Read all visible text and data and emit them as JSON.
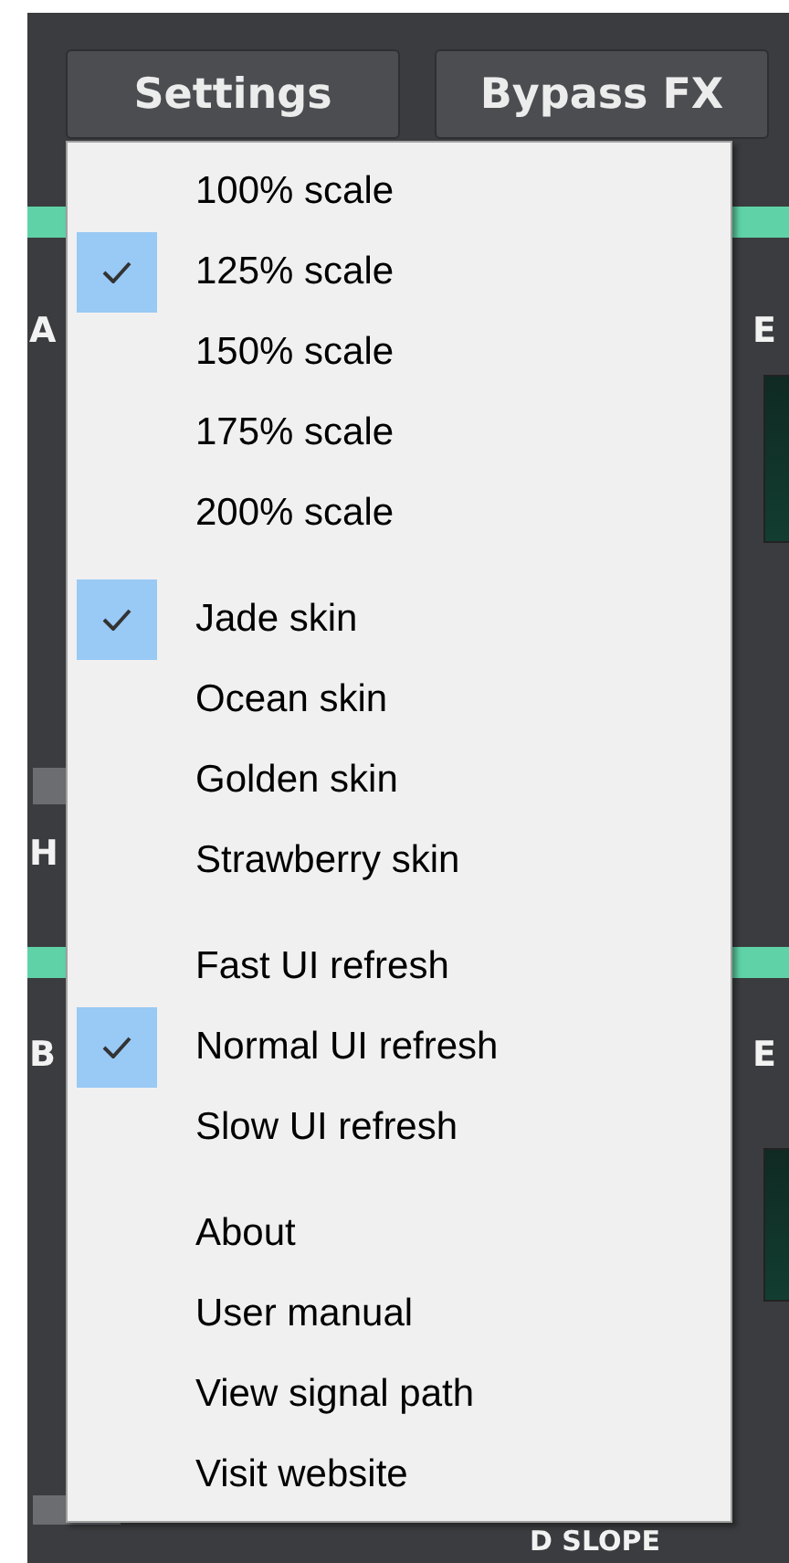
{
  "toolbar": {
    "buttons": [
      {
        "label": "Settings"
      },
      {
        "label": "Bypass FX"
      }
    ]
  },
  "background_labels": [
    "A",
    "E",
    "H",
    "B",
    "E",
    "D SLOPE"
  ],
  "settings_menu": {
    "sections": [
      {
        "items": [
          {
            "label": "100% scale",
            "checked": false
          },
          {
            "label": "125% scale",
            "checked": true
          },
          {
            "label": "150% scale",
            "checked": false
          },
          {
            "label": "175% scale",
            "checked": false
          },
          {
            "label": "200% scale",
            "checked": false
          }
        ]
      },
      {
        "items": [
          {
            "label": "Jade skin",
            "checked": true
          },
          {
            "label": "Ocean skin",
            "checked": false
          },
          {
            "label": "Golden skin",
            "checked": false
          },
          {
            "label": "Strawberry skin",
            "checked": false
          }
        ]
      },
      {
        "items": [
          {
            "label": "Fast UI refresh",
            "checked": false
          },
          {
            "label": "Normal UI refresh",
            "checked": true
          },
          {
            "label": "Slow UI refresh",
            "checked": false
          }
        ]
      },
      {
        "items": [
          {
            "label": "About",
            "checked": false
          },
          {
            "label": "User manual",
            "checked": false
          },
          {
            "label": "View signal path",
            "checked": false
          },
          {
            "label": "Visit website",
            "checked": false
          }
        ]
      }
    ]
  }
}
